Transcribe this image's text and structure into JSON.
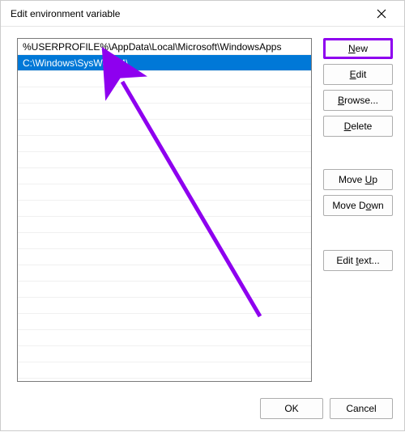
{
  "dialog": {
    "title": "Edit environment variable"
  },
  "list": {
    "rows": [
      {
        "text": "%USERPROFILE%\\AppData\\Local\\Microsoft\\WindowsApps",
        "selected": false
      },
      {
        "text": "C:\\Windows\\SysWow64\\",
        "selected": true
      }
    ],
    "blank_count": 19
  },
  "buttons": {
    "new": {
      "pre": "",
      "mn": "N",
      "post": "ew"
    },
    "edit": {
      "pre": "",
      "mn": "E",
      "post": "dit"
    },
    "browse": {
      "pre": "",
      "mn": "B",
      "post": "rowse..."
    },
    "delete": {
      "pre": "",
      "mn": "D",
      "post": "elete"
    },
    "moveup": {
      "pre": "Move ",
      "mn": "U",
      "post": "p"
    },
    "movedown": {
      "pre": "Move D",
      "mn": "o",
      "post": "wn"
    },
    "edittext": {
      "pre": "Edit ",
      "mn": "t",
      "post": "ext..."
    },
    "ok": "OK",
    "cancel": "Cancel"
  },
  "annotation": {
    "color": "#8e00ef"
  }
}
